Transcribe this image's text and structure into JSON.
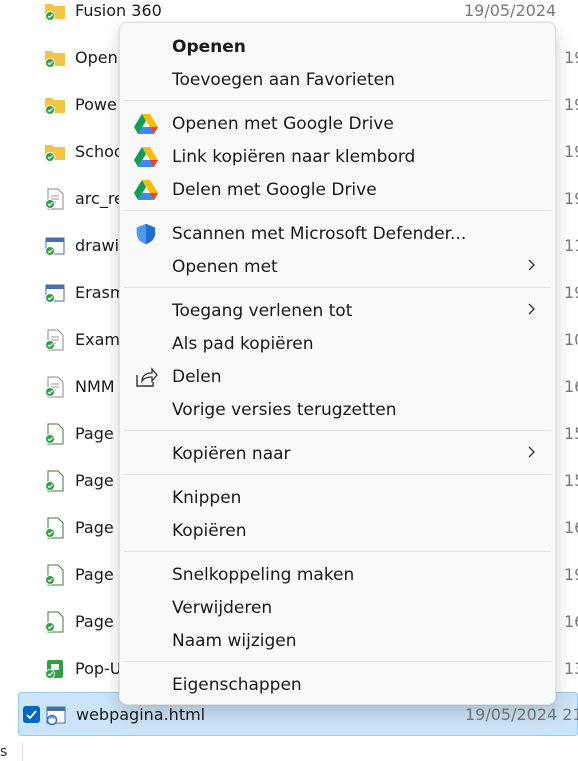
{
  "files": [
    {
      "name": "Fusion 360",
      "date": "19/05/2024"
    },
    {
      "name": "Open",
      "date": ""
    },
    {
      "name": "Powe",
      "date": ""
    },
    {
      "name": "Schoo",
      "date": ""
    },
    {
      "name": "arc_re",
      "date": ""
    },
    {
      "name": "drawi",
      "date": ""
    },
    {
      "name": "Erasm",
      "date": ""
    },
    {
      "name": "Exam",
      "date": ""
    },
    {
      "name": "NMM",
      "date": ""
    },
    {
      "name": "Page",
      "date": ""
    },
    {
      "name": "Page",
      "date": ""
    },
    {
      "name": "Page",
      "date": ""
    },
    {
      "name": "Page",
      "date": ""
    },
    {
      "name": "Page",
      "date": ""
    },
    {
      "name": "Pop-U",
      "date": ""
    },
    {
      "name": "webpagina.html",
      "date": "19/05/2024 21"
    }
  ],
  "date_stubs": [
    "19",
    "19",
    "19",
    "19",
    "11",
    "19",
    "10",
    "16",
    "15",
    "15",
    "16",
    "19",
    "16",
    "13"
  ],
  "status_tail": "s",
  "menu": {
    "open": "Openen",
    "add_favorites": "Toevoegen aan Favorieten",
    "open_drive": "Openen met Google Drive",
    "copy_link": "Link kopiëren naar klembord",
    "share_drive": "Delen met Google Drive",
    "scan_defender": "Scannen met Microsoft Defender...",
    "open_with": "Openen met",
    "grant_access": "Toegang verlenen tot",
    "copy_path": "Als pad kopiëren",
    "share": "Delen",
    "restore_versions": "Vorige versies terugzetten",
    "copy_to": "Kopiëren naar",
    "cut": "Knippen",
    "copy": "Kopiëren",
    "create_shortcut": "Snelkoppeling maken",
    "delete": "Verwijderen",
    "rename": "Naam wijzigen",
    "properties": "Eigenschappen"
  },
  "colors": {
    "folder": "#f4c544",
    "sync_green": "#2ea043",
    "selection": "#cce4f7",
    "checkbox": "#0067c0",
    "defender_blue": "#1f6fd1"
  },
  "icons": {
    "folder": "folder-icon",
    "file": "file-icon",
    "html_file": "html-file-icon",
    "drive": "google-drive-icon",
    "defender": "defender-shield-icon",
    "share": "share-icon",
    "chevron": "chevron-right-icon"
  }
}
